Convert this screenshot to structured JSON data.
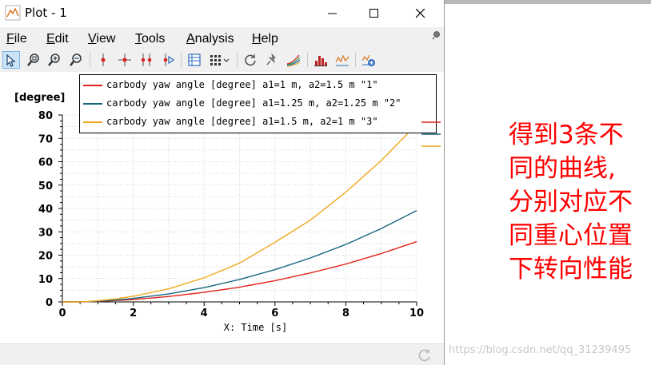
{
  "window": {
    "title": "Plot - 1",
    "controls": {
      "minimize": "minimize",
      "maximize": "maximize",
      "close": "close"
    }
  },
  "menu": [
    {
      "label": "File",
      "mnemonic": "F",
      "rest": "ile"
    },
    {
      "label": "Edit",
      "mnemonic": "E",
      "rest": "dit"
    },
    {
      "label": "View",
      "mnemonic": "V",
      "rest": "iew"
    },
    {
      "label": "Tools",
      "mnemonic": "T",
      "rest": "ools"
    },
    {
      "label": "Analysis",
      "mnemonic": "A",
      "rest": "nalysis"
    },
    {
      "label": "Help",
      "mnemonic": "H",
      "rest": "elp"
    }
  ],
  "toolbar": [
    "select-pointer-icon",
    "zoom-region-icon",
    "zoom-in-icon",
    "zoom-out-icon",
    "marker-icon",
    "crosshair-icon",
    "double-marker-icon",
    "marker-play-icon",
    "table-icon",
    "grid-layout-icon",
    "refresh-icon",
    "pin-remove-icon",
    "multi-curve-icon",
    "histogram-icon",
    "signal-analysis-icon",
    "add-plot-icon"
  ],
  "chart_data": {
    "type": "line",
    "ylabel": "[degree]",
    "xlabel": "X: Time [s]",
    "xlim": [
      0,
      10
    ],
    "ylim": [
      0,
      80
    ],
    "xticks": [
      0,
      2,
      4,
      6,
      8,
      10
    ],
    "yticks": [
      0,
      10,
      20,
      30,
      40,
      50,
      60,
      70,
      80
    ],
    "grid": true,
    "legend_position": "top",
    "series": [
      {
        "name": "carbody yaw angle [degree] a1=1 m, a2=1.5 m \"1\"",
        "color": "#e3221b",
        "x": [
          0,
          0.5,
          1,
          1.5,
          2,
          3,
          4,
          5,
          6,
          7,
          8,
          9,
          10
        ],
        "y": [
          0,
          0,
          0.2,
          0.6,
          1.0,
          2.3,
          4.1,
          6.3,
          9.1,
          12.4,
          16.2,
          20.7,
          25.8
        ]
      },
      {
        "name": "carbody yaw angle [degree] a1=1.25 m, a2=1.25 m \"2\"",
        "color": "#17687e",
        "x": [
          0,
          0.5,
          1,
          1.5,
          2,
          3,
          4,
          5,
          6,
          7,
          8,
          9,
          10
        ],
        "y": [
          0,
          0,
          0.3,
          0.8,
          1.5,
          3.4,
          6.1,
          9.6,
          13.8,
          18.8,
          24.6,
          31.4,
          39.1
        ]
      },
      {
        "name": "carbody yaw angle [degree] a1=1.5 m, a2=1 m \"3\"",
        "color": "#f0a81e",
        "x": [
          0,
          0.5,
          1,
          1.5,
          2,
          3,
          4,
          5,
          6,
          7,
          8,
          9,
          10
        ],
        "y": [
          0,
          0,
          0.5,
          1.3,
          2.4,
          5.6,
          10.3,
          16.6,
          25.5,
          35.0,
          47.0,
          60.5,
          76.0
        ]
      }
    ]
  },
  "annotation": {
    "lines": [
      "得到3条不",
      "同的曲线,",
      "分别对应不",
      "同重心位置",
      "下转向性能"
    ],
    "color": "#ff0000"
  },
  "watermark": "https://blog.csdn.net/qq_31239495"
}
